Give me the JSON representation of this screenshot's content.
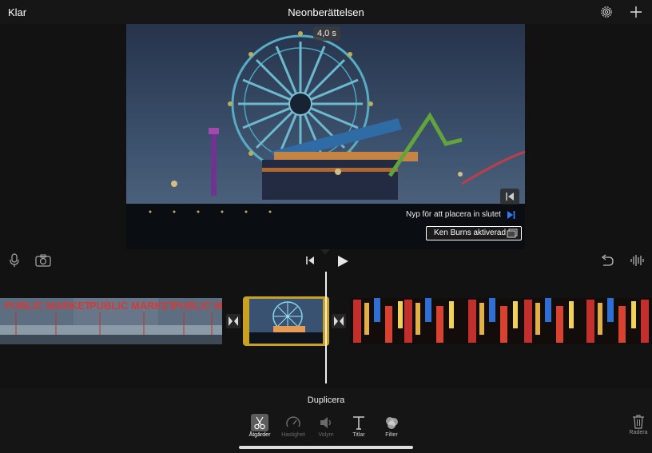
{
  "topbar": {
    "done_label": "Klar",
    "project_title": "Neonberättelsen",
    "settings_icon": "gear-icon",
    "add_icon": "plus-icon"
  },
  "viewer": {
    "duration_label": "4,0 s",
    "pinch_hint": "Nyp för att placera in slutet",
    "ken_burns_label": "Ken Burns aktiverad"
  },
  "controls": {
    "mic_icon": "microphone-icon",
    "camera_icon": "camera-icon",
    "skip_icon": "skip-to-start-icon",
    "play_icon": "play-icon",
    "undo_icon": "undo-icon",
    "audio_icon": "waveform-icon"
  },
  "timeline": {
    "clips": [
      {
        "name": "Public Market neon sign",
        "sign_text": "PUBLIC MARKET"
      },
      {
        "name": "Ferris wheel at dusk",
        "selected": true
      },
      {
        "name": "Neon street signs at night"
      }
    ]
  },
  "toolbar": {
    "action_title": "Duplicera",
    "tools": [
      {
        "label": "Åtgärder",
        "icon": "scissors-icon",
        "active": true
      },
      {
        "label": "Hastighet",
        "icon": "speedometer-icon",
        "active": false
      },
      {
        "label": "Volym",
        "icon": "speaker-icon",
        "active": false
      },
      {
        "label": "Titlar",
        "icon": "text-icon",
        "active": false
      },
      {
        "label": "Filter",
        "icon": "filter-icon",
        "active": false
      }
    ],
    "delete_label": "Radera"
  },
  "colors": {
    "selection": "#c7a11f",
    "accent": "#2f7df6",
    "background": "#121212"
  }
}
